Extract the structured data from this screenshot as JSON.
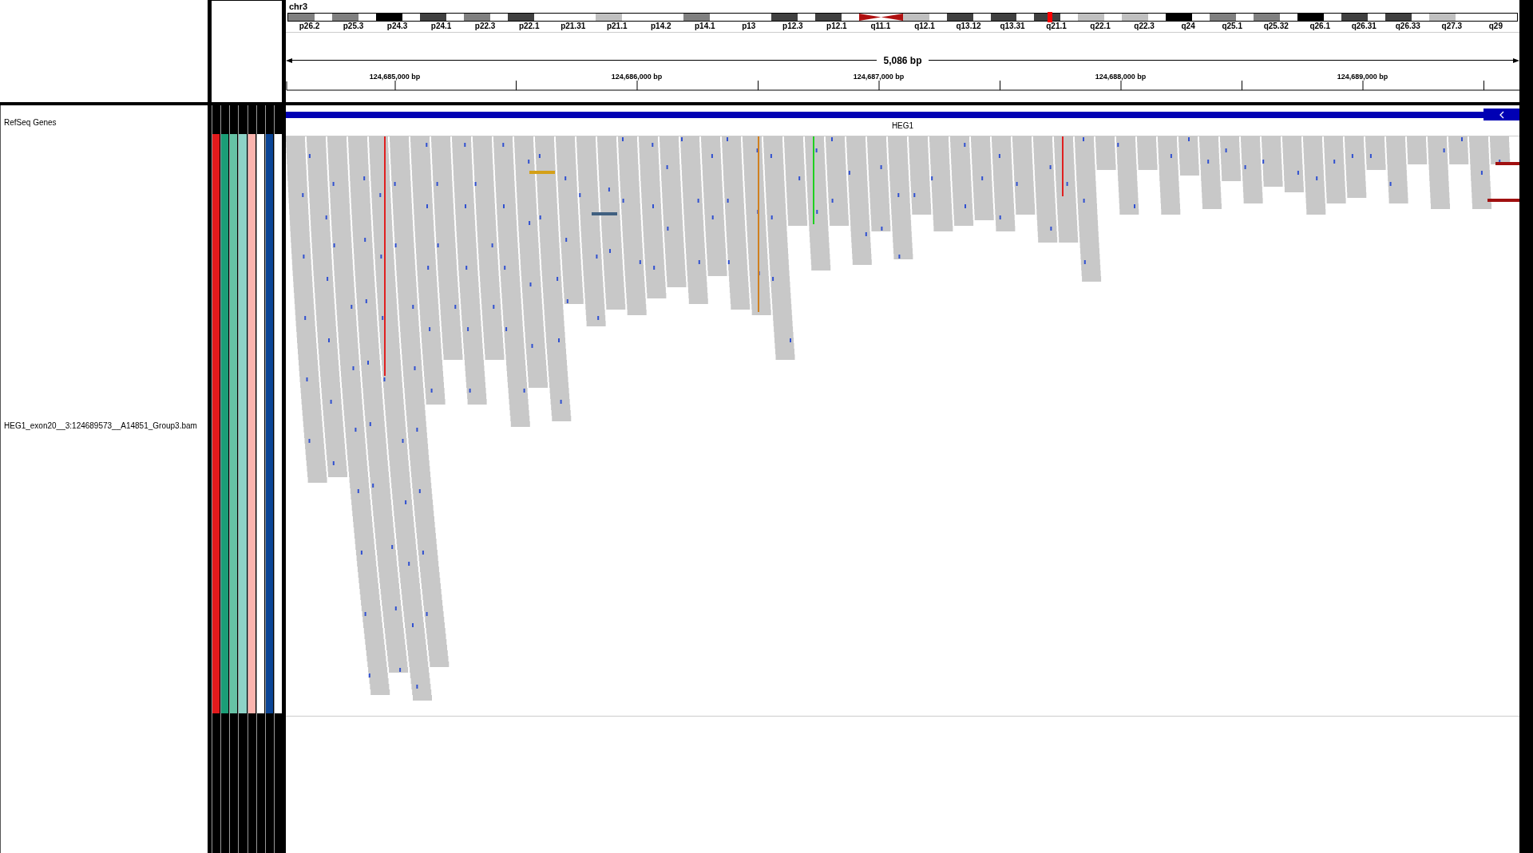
{
  "ideogram": {
    "chromosome": "chr3",
    "bands": [
      {
        "kind": "band",
        "label": "p26.2",
        "color": "#808080",
        "selected": false
      },
      {
        "kind": "band",
        "label": "p25.3",
        "color": "#808080",
        "selected": false
      },
      {
        "kind": "band",
        "label": "p24.3",
        "color": "#000000",
        "selected": false
      },
      {
        "kind": "band",
        "label": "p24.1",
        "color": "#404040",
        "selected": false
      },
      {
        "kind": "band",
        "label": "p22.3",
        "color": "#808080",
        "selected": false
      },
      {
        "kind": "band",
        "label": "p22.1",
        "color": "#404040",
        "selected": false
      },
      {
        "kind": "band",
        "label": "p21.31",
        "color": "#ffffff",
        "selected": false
      },
      {
        "kind": "band",
        "label": "p21.1",
        "color": "#c0c0c0",
        "selected": false
      },
      {
        "kind": "band",
        "label": "p14.2",
        "color": "#ffffff",
        "selected": false
      },
      {
        "kind": "band",
        "label": "p14.1",
        "color": "#808080",
        "selected": false
      },
      {
        "kind": "band",
        "label": "p13",
        "color": "#ffffff",
        "selected": false
      },
      {
        "kind": "band",
        "label": "p12.3",
        "color": "#404040",
        "selected": false
      },
      {
        "kind": "band",
        "label": "p12.1",
        "color": "#404040",
        "selected": false
      },
      {
        "kind": "centromere",
        "label": "q11.1",
        "color": "#b01010",
        "selected": false
      },
      {
        "kind": "band",
        "label": "q12.1",
        "color": "#c0c0c0",
        "selected": false
      },
      {
        "kind": "band",
        "label": "q13.12",
        "color": "#404040",
        "selected": false
      },
      {
        "kind": "band",
        "label": "q13.31",
        "color": "#404040",
        "selected": false
      },
      {
        "kind": "band",
        "label": "q21.1",
        "color": "#404040",
        "selected": true
      },
      {
        "kind": "band",
        "label": "q22.1",
        "color": "#c0c0c0",
        "selected": false
      },
      {
        "kind": "band",
        "label": "q22.3",
        "color": "#c0c0c0",
        "selected": false
      },
      {
        "kind": "band",
        "label": "q24",
        "color": "#000000",
        "selected": false
      },
      {
        "kind": "band",
        "label": "q25.1",
        "color": "#808080",
        "selected": false
      },
      {
        "kind": "band",
        "label": "q25.32",
        "color": "#808080",
        "selected": false
      },
      {
        "kind": "band",
        "label": "q26.1",
        "color": "#000000",
        "selected": false
      },
      {
        "kind": "band",
        "label": "q26.31",
        "color": "#404040",
        "selected": false
      },
      {
        "kind": "band",
        "label": "q26.33",
        "color": "#404040",
        "selected": false
      },
      {
        "kind": "band",
        "label": "q27.3",
        "color": "#c0c0c0",
        "selected": false
      },
      {
        "kind": "band",
        "label": "q29",
        "color": "#ffffff",
        "selected": false
      }
    ]
  },
  "ruler": {
    "span": "5,086 bp",
    "ticks": [
      "124,685,000 bp",
      "124,686,000 bp",
      "124,687,000 bp",
      "124,688,000 bp",
      "124,689,000 bp"
    ]
  },
  "tracks": [
    {
      "kind": "gene",
      "name": "RefSeq Genes",
      "feature": {
        "name": "HEG1",
        "reverse_strand": true
      }
    },
    {
      "kind": "alignment",
      "name": "HEG1_exon20__3:124689573__A14851_Group3.bam"
    }
  ],
  "attributes": [
    {
      "color": "#e31a1c"
    },
    {
      "color": "#1b9e77"
    },
    {
      "color": "#66c2a5"
    },
    {
      "color": "#8dd3c7"
    },
    {
      "color": "#fbb4ae"
    },
    {
      "color": "#ffffff"
    },
    {
      "color": "#0b4596"
    },
    {
      "color": "#ffffff"
    }
  ]
}
